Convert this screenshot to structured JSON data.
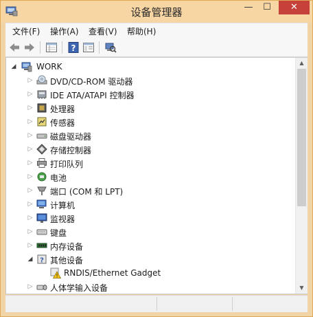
{
  "window": {
    "title": "设备管理器",
    "buttons": {
      "minimize": "—",
      "maximize": "☐",
      "close": "✕"
    }
  },
  "menu": [
    {
      "label": "文件(F)"
    },
    {
      "label": "操作(A)"
    },
    {
      "label": "查看(V)"
    },
    {
      "label": "帮助(H)"
    }
  ],
  "toolbar": {
    "buttons": [
      "back-arrow-icon",
      "forward-arrow-icon",
      "properties-grid-icon",
      "help-icon",
      "console-tree-icon",
      "scan-hardware-icon"
    ]
  },
  "tree": {
    "root": "WORK",
    "items": [
      {
        "label": "DVD/CD-ROM 驱动器",
        "icon": "dvd-drive-icon",
        "expanded": false
      },
      {
        "label": "IDE ATA/ATAPI 控制器",
        "icon": "ide-controller-icon",
        "expanded": false
      },
      {
        "label": "处理器",
        "icon": "processor-icon",
        "expanded": false
      },
      {
        "label": "传感器",
        "icon": "sensor-icon",
        "expanded": false
      },
      {
        "label": "磁盘驱动器",
        "icon": "disk-drive-icon",
        "expanded": false
      },
      {
        "label": "存储控制器",
        "icon": "storage-controller-icon",
        "expanded": false
      },
      {
        "label": "打印队列",
        "icon": "printer-icon",
        "expanded": false
      },
      {
        "label": "电池",
        "icon": "battery-icon",
        "expanded": false
      },
      {
        "label": "端口 (COM 和 LPT)",
        "icon": "port-icon",
        "expanded": false
      },
      {
        "label": "计算机",
        "icon": "computer-icon",
        "expanded": false
      },
      {
        "label": "监视器",
        "icon": "monitor-icon",
        "expanded": false
      },
      {
        "label": "键盘",
        "icon": "keyboard-icon",
        "expanded": false
      },
      {
        "label": "内存设备",
        "icon": "memory-icon",
        "expanded": false
      },
      {
        "label": "其他设备",
        "icon": "other-devices-icon",
        "expanded": true
      },
      {
        "label": "人体学输入设备",
        "icon": "hid-icon",
        "expanded": false
      }
    ],
    "child": {
      "label": "RNDIS/Ethernet Gadget",
      "icon": "warning-device-icon",
      "parent": "其他设备"
    }
  },
  "colors": {
    "frame": "#f0d3a6",
    "close": "#c7413b",
    "content_bg": "#ffffff"
  }
}
